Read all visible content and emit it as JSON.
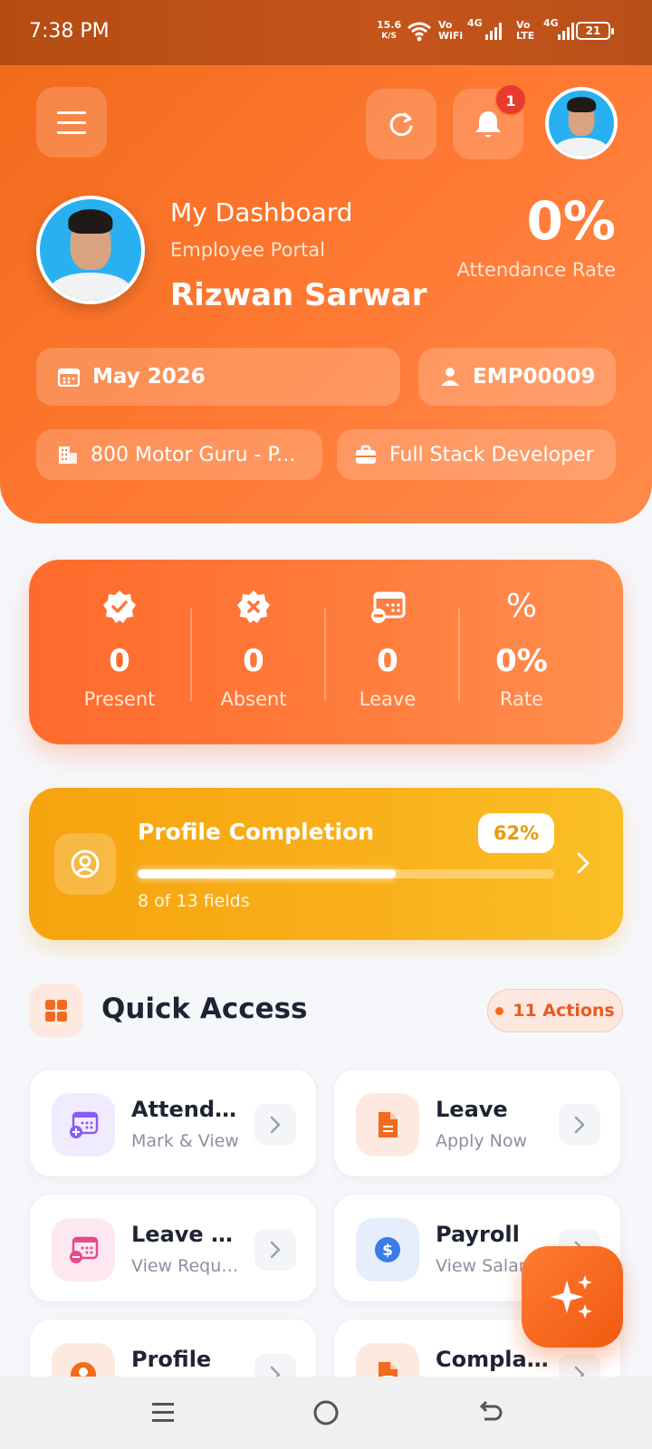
{
  "status_bar": {
    "time": "7:38 PM",
    "net_speed_value": "15.6",
    "net_speed_unit": "K/S",
    "wifi_label_top": "Vo",
    "wifi_label_bottom": "WiFi",
    "sim1_label": "4G",
    "volte_top": "Vo",
    "volte_bottom": "LTE",
    "sim2_label": "4G",
    "battery": "21"
  },
  "header": {
    "notification_count": "1",
    "title": "My Dashboard",
    "subtitle": "Employee Portal",
    "employee_name": "Rizwan Sarwar",
    "attendance_rate_value": "0%",
    "attendance_rate_label": "Attendance Rate",
    "month": "May 2026",
    "employee_id": "EMP00009",
    "company": "800 Motor Guru - P...",
    "designation": "Full Stack Developer"
  },
  "stats": [
    {
      "value": "0",
      "label": "Present",
      "icon": "check-badge-icon"
    },
    {
      "value": "0",
      "label": "Absent",
      "icon": "x-badge-icon"
    },
    {
      "value": "0",
      "label": "Leave",
      "icon": "calendar-minus-icon"
    },
    {
      "value": "0%",
      "label": "Rate",
      "icon": "percent-icon"
    }
  ],
  "profile_completion": {
    "title": "Profile Completion",
    "percent_label": "62%",
    "progress_fraction": 0.62,
    "fields_text": "8 of 13 fields"
  },
  "quick_access": {
    "title": "Quick Access",
    "actions_badge": "11 Actions",
    "tiles": [
      {
        "title": "Attenda...",
        "subtitle": "Mark & View",
        "icon": "calendar-plus-icon",
        "color": "#8a5cf6",
        "bg": "#f1ebff"
      },
      {
        "title": "Leave",
        "subtitle": "Apply Now",
        "icon": "document-icon",
        "color": "#f26a1b",
        "bg": "#fde9df"
      },
      {
        "title": "Leave Hi...",
        "subtitle": "View Reque...",
        "icon": "calendar-minus-icon",
        "color": "#e64a8a",
        "bg": "#fde8f1"
      },
      {
        "title": "Payroll",
        "subtitle": "View Salary",
        "icon": "dollar-icon",
        "color": "#3b7bea",
        "bg": "#e6eefc"
      },
      {
        "title": "Profile",
        "subtitle": "",
        "icon": "user-icon",
        "color": "#f26a1b",
        "bg": "#fde9df"
      },
      {
        "title": "Complai...",
        "subtitle": "",
        "icon": "document-icon",
        "color": "#f26a1b",
        "bg": "#fde9df"
      }
    ]
  },
  "colors": {
    "primary": "#f26a1b",
    "warning": "#f9b11b",
    "text_dark": "#1f2434"
  }
}
